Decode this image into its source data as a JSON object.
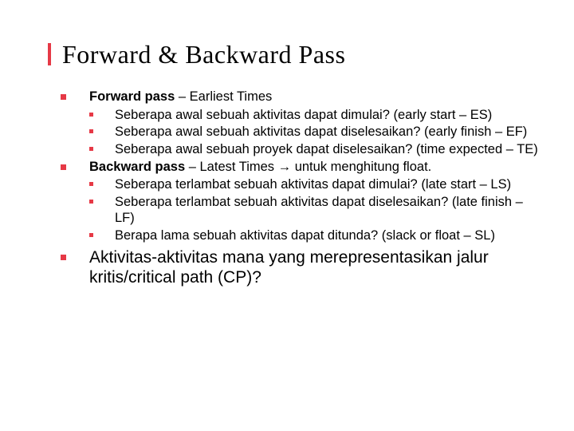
{
  "title": "Forward & Backward Pass",
  "forward": {
    "heading_bold": "Forward pass",
    "heading_rest": " – Earliest Times",
    "items": [
      "Seberapa awal sebuah aktivitas dapat dimulai? (early start – ES)",
      "Seberapa awal sebuah aktivitas dapat diselesaikan? (early finish – EF)",
      "Seberapa awal sebuah proyek dapat diselesaikan? (time expected – TE)"
    ]
  },
  "backward": {
    "heading_bold": "Backward pass",
    "heading_rest": " – Latest Times → untuk menghitung float.",
    "items": [
      "Seberapa terlambat sebuah aktivitas dapat dimulai? (late start – LS)",
      "Seberapa terlambat sebuah aktivitas dapat diselesaikan? (late finish – LF)",
      "Berapa lama sebuah aktivitas dapat ditunda? (slack or float – SL)"
    ]
  },
  "closing": "Aktivitas-aktivitas mana yang merepresentasikan jalur kritis/critical path (CP)?"
}
